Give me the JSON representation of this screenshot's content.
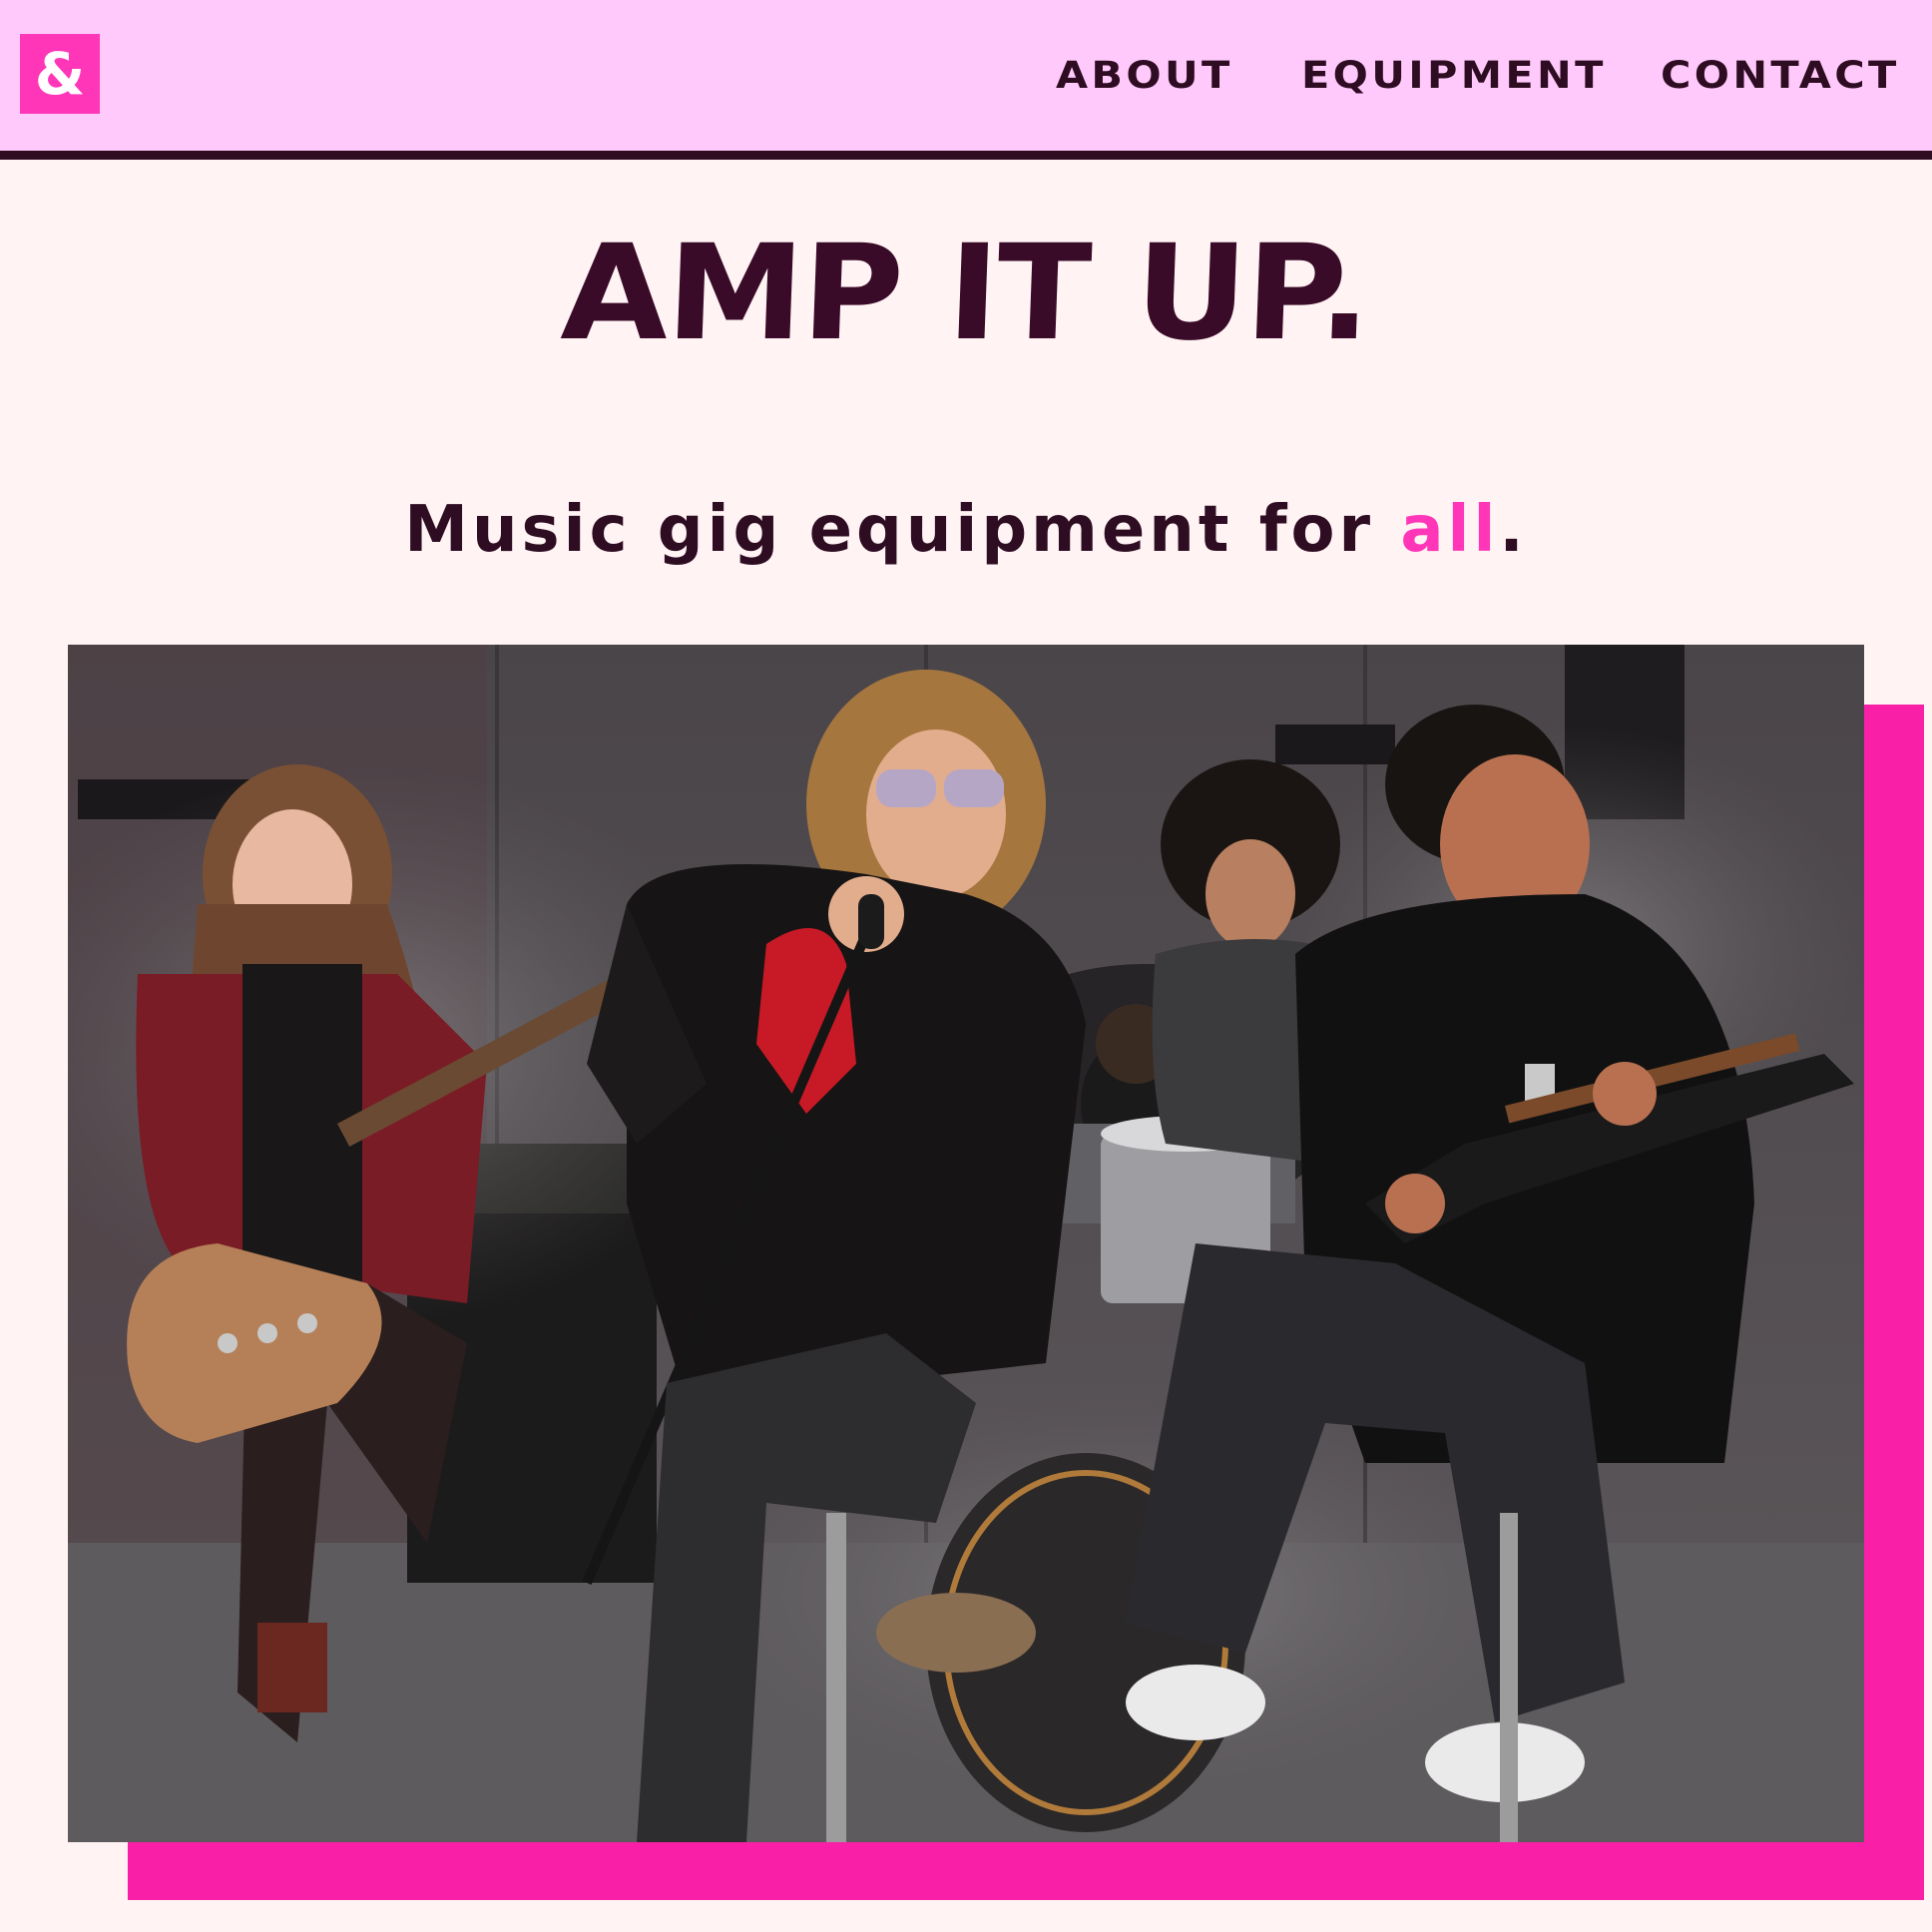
{
  "logo": {
    "glyph": "&"
  },
  "nav": {
    "about": "ABOUT",
    "equipment": "EQUIPMENT",
    "contact": "CONTACT"
  },
  "hero": {
    "title": "AMP IT UP.",
    "tagline_before": "Music gig equipment for ",
    "tagline_accent": "all",
    "tagline_after": "."
  },
  "colors": {
    "header_bg": "#ffc9fb",
    "page_bg": "#fff3f3",
    "accent": "#ff36b8",
    "dark": "#2e0c22",
    "photo_shadow": "#fa1fa7"
  }
}
